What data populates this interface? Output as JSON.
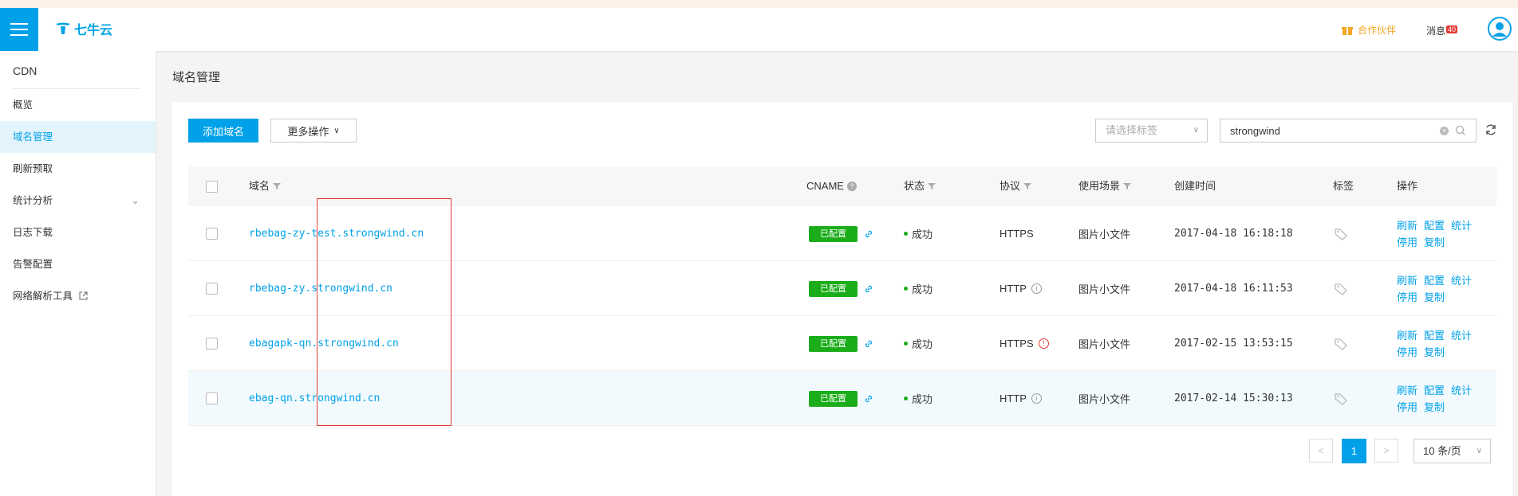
{
  "header": {
    "logo_text": "七牛云",
    "partner_label": "合作伙伴",
    "message_label": "消息",
    "message_count": "40"
  },
  "sidebar": {
    "title": "CDN",
    "items": [
      {
        "label": "概览"
      },
      {
        "label": "域名管理"
      },
      {
        "label": "刷新预取"
      },
      {
        "label": "统计分析"
      },
      {
        "label": "日志下载"
      },
      {
        "label": "告警配置"
      },
      {
        "label": "网络解析工具"
      }
    ]
  },
  "page": {
    "title": "域名管理"
  },
  "toolbar": {
    "add_domain": "添加域名",
    "more_actions": "更多操作",
    "tag_placeholder": "请选择标签",
    "search_value": "strongwind"
  },
  "table": {
    "headers": {
      "domain": "域名",
      "cname": "CNAME",
      "status": "状态",
      "protocol": "协议",
      "scene": "使用场景",
      "created": "创建时间",
      "tags": "标签",
      "actions": "操作"
    },
    "action_labels": [
      "刷新",
      "配置",
      "统计",
      "停用",
      "复制"
    ],
    "rows": [
      {
        "domain": "rbebag-zy-test.strongwind.cn",
        "cname": "已配置",
        "status": "成功",
        "protocol": "HTTPS",
        "scene": "图片小文件",
        "created": "2017-04-18 16:18:18"
      },
      {
        "domain": "rbebag-zy.strongwind.cn",
        "cname": "已配置",
        "status": "成功",
        "protocol": "HTTP",
        "scene": "图片小文件",
        "created": "2017-04-18 16:11:53"
      },
      {
        "domain": "ebagapk-qn.strongwind.cn",
        "cname": "已配置",
        "status": "成功",
        "protocol": "HTTPS",
        "scene": "图片小文件",
        "created": "2017-02-15 13:53:15"
      },
      {
        "domain": "ebag-qn.strongwind.cn",
        "cname": "已配置",
        "status": "成功",
        "protocol": "HTTP",
        "scene": "图片小文件",
        "created": "2017-02-14 15:30:13"
      }
    ]
  },
  "pagination": {
    "prev": "<",
    "current_page": "1",
    "next": ">",
    "page_size": "10 条/页"
  },
  "colors": {
    "accent": "#00a1e9",
    "success": "#1aad19",
    "highlight_box": "#e53935"
  }
}
